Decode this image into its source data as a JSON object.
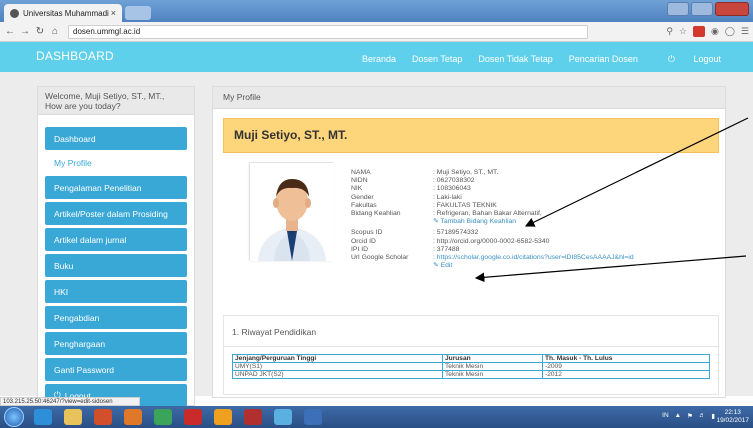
{
  "browser": {
    "tab_title": "Universitas Muhammadi",
    "tab_close": "×",
    "url": "dosen.ummgl.ac.id"
  },
  "navbar": {
    "brand": "DASHBOARD",
    "links": [
      "Beranda",
      "Dosen Tetap",
      "Dosen Tidak Tetap",
      "Pencarian Dosen"
    ],
    "logout": "Logout"
  },
  "sidebar": {
    "welcome_line1": "Welcome, Muji Setiyo, ST., MT.,",
    "welcome_line2": "How are you today?",
    "items": [
      {
        "label": "Dashboard",
        "active": true
      },
      {
        "label": "My Profile",
        "active": false
      },
      {
        "label": "Pengalaman Penelitian",
        "active": true
      },
      {
        "label": "Artikel/Poster dalam Prosiding",
        "active": true
      },
      {
        "label": "Artikel dalam jurnal",
        "active": true
      },
      {
        "label": "Buku",
        "active": true
      },
      {
        "label": "HKI",
        "active": true
      },
      {
        "label": "Pengabdian",
        "active": true
      },
      {
        "label": "Penghargaan",
        "active": true
      },
      {
        "label": "Ganti Password",
        "active": true
      },
      {
        "label": "Logout",
        "active": true
      }
    ]
  },
  "main": {
    "panel_title": "My Profile",
    "name": "Muji Setiyo, ST., MT.",
    "profile": [
      {
        "label": "NAMA",
        "value": ": Muji Setiyo, ST., MT."
      },
      {
        "label": "NIDN",
        "value": ": 0627038302"
      },
      {
        "label": "NIK",
        "value": ": 108306043"
      },
      {
        "label": "Gender",
        "value": ": Laki-laki"
      },
      {
        "label": "Fakultas",
        "value": ": FAKULTAS TEKNIK"
      },
      {
        "label": "Bidang Keahlian",
        "value": ": Refrigeran, Bahan Bakar Alternatif,"
      }
    ],
    "tambah_link": "Tambah Bidang Keahlian",
    "profile2": [
      {
        "label": "Scopus ID",
        "value": ": 57189574332"
      },
      {
        "label": "Orcid ID",
        "value": ": http://orcid.org/0000-0002-6582-5340"
      },
      {
        "label": "IPI ID",
        "value": ": 377488"
      },
      {
        "label": "Url Google Scholar",
        "value": ": https://scholar.google.co.id/citations?user=lDI85CesAAAAJ&hl=id"
      }
    ],
    "edit_link": "Edit",
    "education": {
      "title": "1. Riwayat Pendidikan",
      "headers": [
        "Jenjang/Perguruan Tinggi",
        "Jurusan",
        "Th. Masuk - Th. Lulus"
      ],
      "rows": [
        [
          "UMY(S1)",
          "Teknik Mesin",
          "-2009"
        ],
        [
          "UNPAD JKT(S2)",
          "Teknik Mesin",
          "-2012"
        ]
      ]
    }
  },
  "statusbar": "103.215.25.50:46247/?view=edit-sidosen",
  "taskbar": {
    "tray": "IN",
    "time": "22:13",
    "date": "19/02/2017"
  },
  "colors": {
    "navbar": "#5fd0ec",
    "menu": "#3aa8d6",
    "name_box": "#fdd57b"
  }
}
